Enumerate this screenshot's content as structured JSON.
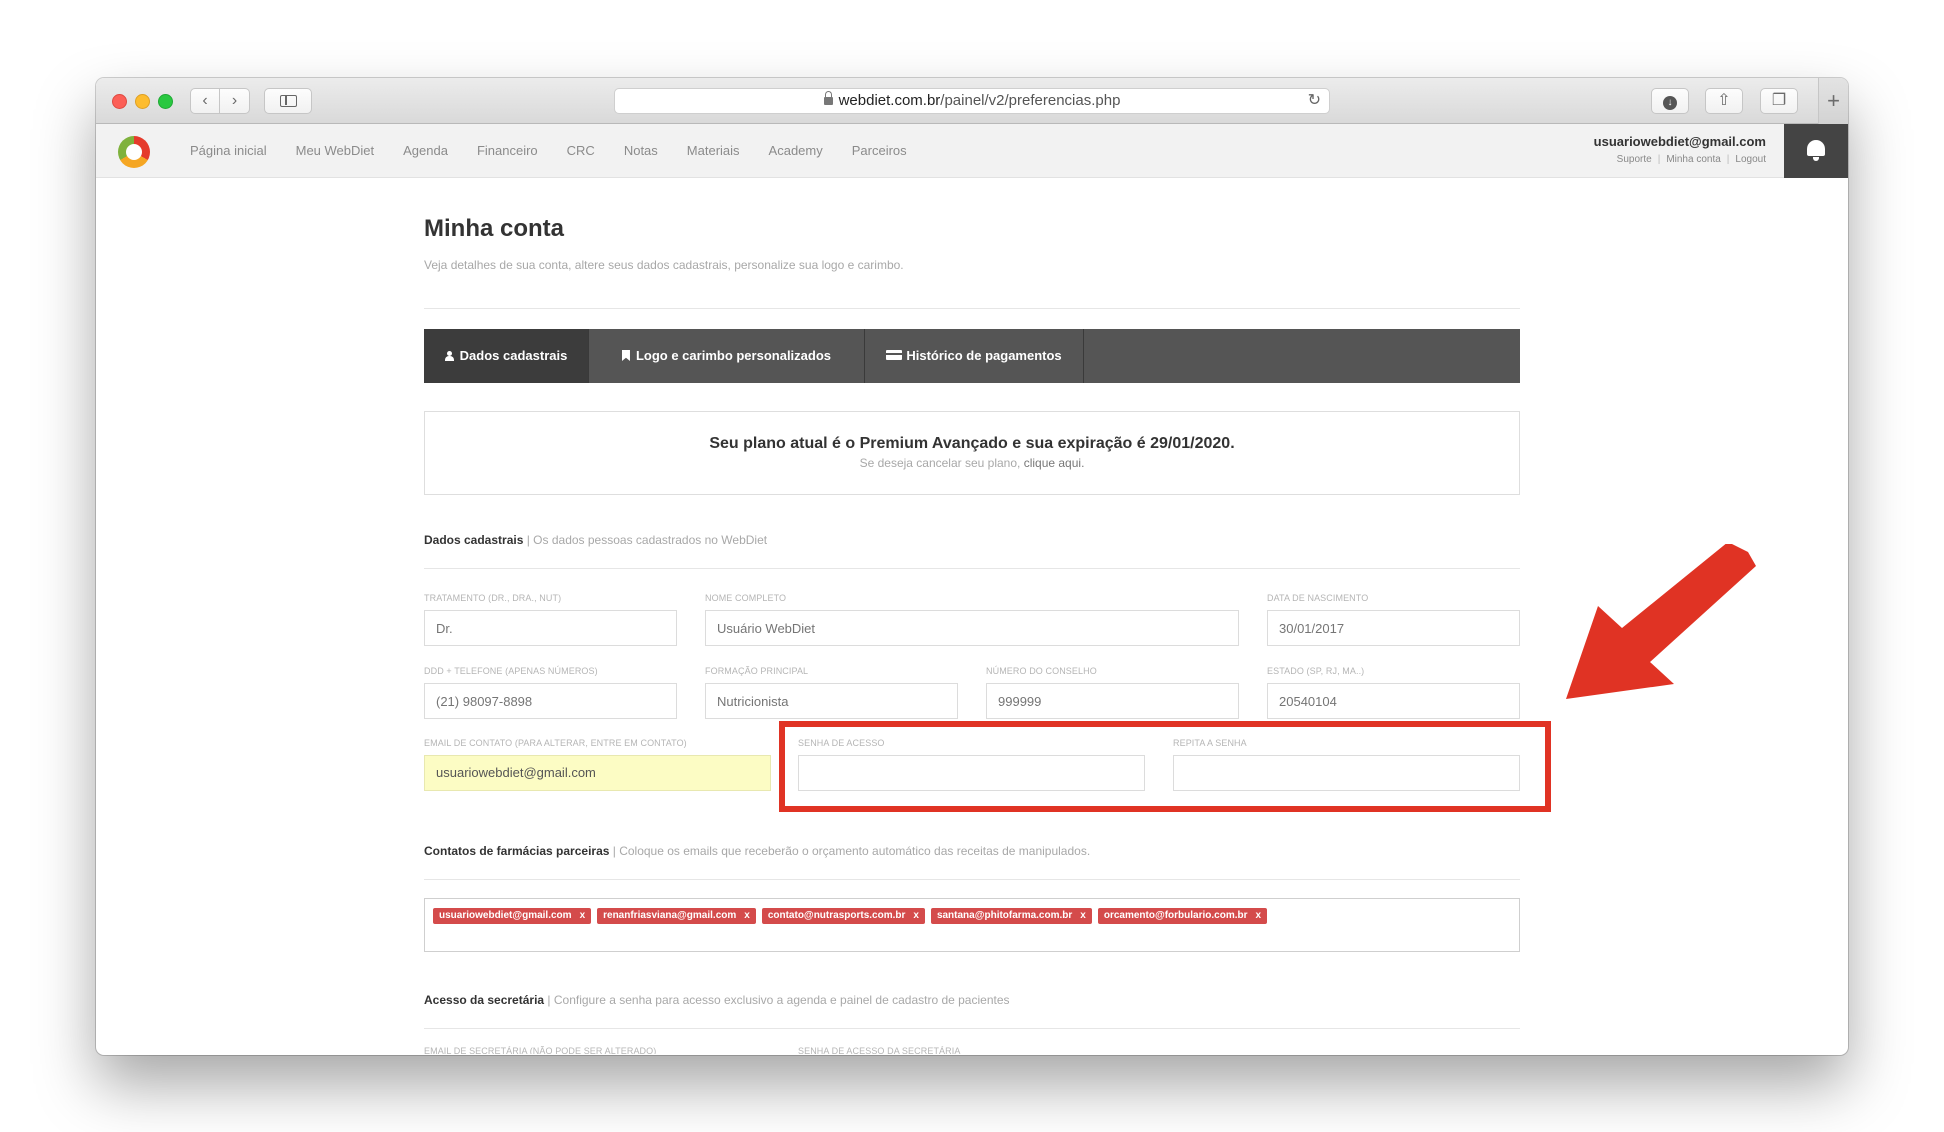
{
  "browser": {
    "url_host": "webdiet.com.br",
    "url_path": "/painel/v2/preferencias.php",
    "nav_back": "‹",
    "nav_forward": "›",
    "new_tab": "+"
  },
  "header": {
    "nav_items": [
      "Página inicial",
      "Meu WebDiet",
      "Agenda",
      "Financeiro",
      "CRC",
      "Notas",
      "Materiais",
      "Academy",
      "Parceiros"
    ],
    "user_email": "usuariowebdiet@gmail.com",
    "user_links": [
      "Suporte",
      "Minha conta",
      "Logout"
    ]
  },
  "page": {
    "title": "Minha conta",
    "subtitle": "Veja detalhes de sua conta, altere seus dados cadastrais, personalize sua logo e carimbo."
  },
  "tabs": [
    {
      "label": "Dados cadastrais",
      "icon": "person-icon",
      "active": true
    },
    {
      "label": "Logo e carimbo personalizados",
      "icon": "bookmark-icon",
      "active": false
    },
    {
      "label": "Histórico de pagamentos",
      "icon": "credit-card-icon",
      "active": false
    }
  ],
  "plan": {
    "text": "Seu plano atual é o Premium Avançado e sua expiração é 29/01/2020.",
    "cancel_prefix": "Se deseja cancelar seu plano, ",
    "cancel_link": "clique aqui."
  },
  "sections": {
    "dados": {
      "title": "Dados cadastrais",
      "desc": " | Os dados pessoas cadastrados no WebDiet"
    },
    "farmacias": {
      "title": "Contatos de farmácias parceiras",
      "desc": " | Coloque os emails que receberão o orçamento automático das receitas de manipulados."
    },
    "secretaria": {
      "title": "Acesso da secretária",
      "desc": " | Configure a senha para acesso exclusivo a agenda e painel de cadastro de pacientes"
    }
  },
  "fields": {
    "tratamento": {
      "label": "Tratamento (Dr., Dra., Nut)",
      "placeholder": "Dr."
    },
    "nome": {
      "label": "Nome completo",
      "placeholder": "Usuário WebDiet"
    },
    "nascimento": {
      "label": "Data de nascimento",
      "placeholder": "30/01/2017"
    },
    "telefone": {
      "label": "DDD + Telefone (apenas números)",
      "placeholder": "(21) 98097-8898"
    },
    "formacao": {
      "label": "Formação principal",
      "placeholder": "Nutricionista"
    },
    "conselho": {
      "label": "Número do conselho",
      "placeholder": "999999"
    },
    "estado": {
      "label": "Estado (SP, RJ, MA..)",
      "placeholder": "20540104"
    },
    "email": {
      "label": "Email de contato (para alterar, entre em contato)",
      "value": "usuariowebdiet@gmail.com"
    },
    "senha": {
      "label": "Senha de acesso",
      "value": ""
    },
    "repita": {
      "label": "Repita a senha",
      "value": ""
    },
    "email_secretaria": {
      "label": "Email de secretária (não pode ser alterado)"
    },
    "senha_secretaria": {
      "label": "Senha de acesso da secretária"
    }
  },
  "pharmacy_tags": [
    "usuariowebdiet@gmail.com",
    "renanfriasviana@gmail.com",
    "contato@nutrasports.com.br",
    "santana@phitofarma.com.br",
    "orcamento@forbulario.com.br"
  ],
  "tag_remove": "x",
  "colors": {
    "annotation": "#e03324",
    "tag": "#d44b4b",
    "tabbar": "#555555"
  }
}
